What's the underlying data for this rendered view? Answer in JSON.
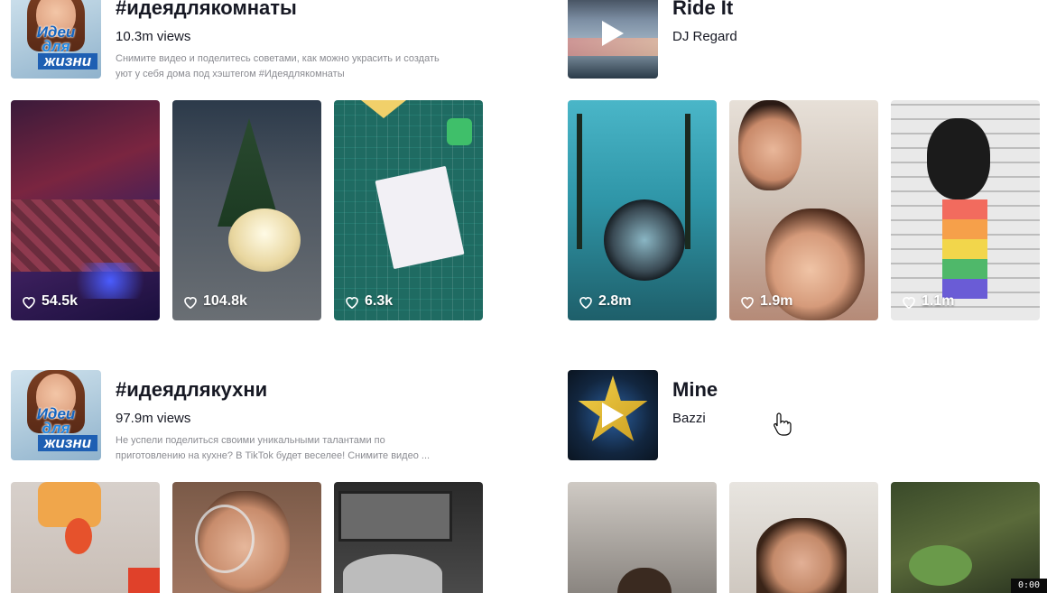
{
  "sections": [
    {
      "title": "#идеядлякомнаты",
      "views": "10.3m views",
      "description": "Снимите видео и поделитесь советами, как можно украсить и создать уют у себя дома под хэштегом #Идеядлякомнаты",
      "cover_text": [
        "Идеи",
        "для",
        "жизни"
      ],
      "videos": [
        {
          "likes": "54.5k"
        },
        {
          "likes": "104.8k"
        },
        {
          "likes": "6.3k"
        }
      ]
    },
    {
      "title": "Ride It",
      "artist": "DJ Regard",
      "videos": [
        {
          "likes": "2.8m"
        },
        {
          "likes": "1.9m"
        },
        {
          "likes": "1.1m"
        }
      ]
    },
    {
      "title": "#идеядлякухни",
      "views": "97.9m views",
      "description": "Не успели поделиться своими уникальными талантами по приготовлению на кухне? В TikTok будет веселее! Снимите видео ...",
      "cover_text": [
        "Идеи",
        "для",
        "жизни"
      ],
      "videos": [
        {},
        {},
        {}
      ]
    },
    {
      "title": "Mine",
      "artist": "Bazzi",
      "videos": [
        {},
        {},
        {}
      ]
    }
  ],
  "timer": "0:00",
  "icons": {
    "like": "heart-icon",
    "play": "play-icon",
    "cursor": "hand-pointer-icon"
  }
}
